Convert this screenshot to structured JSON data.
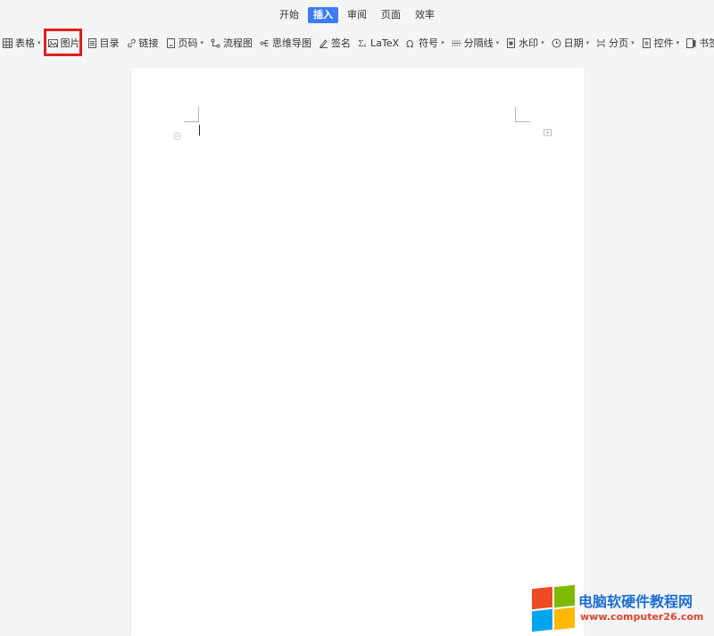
{
  "ribbon_tabs": [
    {
      "label": "开始",
      "active": false
    },
    {
      "label": "插入",
      "active": true
    },
    {
      "label": "审阅",
      "active": false
    },
    {
      "label": "页面",
      "active": false
    },
    {
      "label": "效率",
      "active": false
    }
  ],
  "toolbar": {
    "table": "表格",
    "image": "图片",
    "toc": "目录",
    "link": "链接",
    "page_number": "页码",
    "flowchart": "流程图",
    "mindmap": "思维导图",
    "signature": "签名",
    "latex": "LaTeX",
    "symbol": "符号",
    "divider": "分隔线",
    "watermark": "水印",
    "date": "日期",
    "page_break": "分页",
    "control": "控件",
    "bookmark": "书签"
  },
  "colors": {
    "accent": "#3d7cf4",
    "highlight_border": "#e0201c",
    "background": "#f4f5f7"
  },
  "watermark": {
    "title": "电脑软硬件教程网",
    "url": "www.computer26.com"
  }
}
